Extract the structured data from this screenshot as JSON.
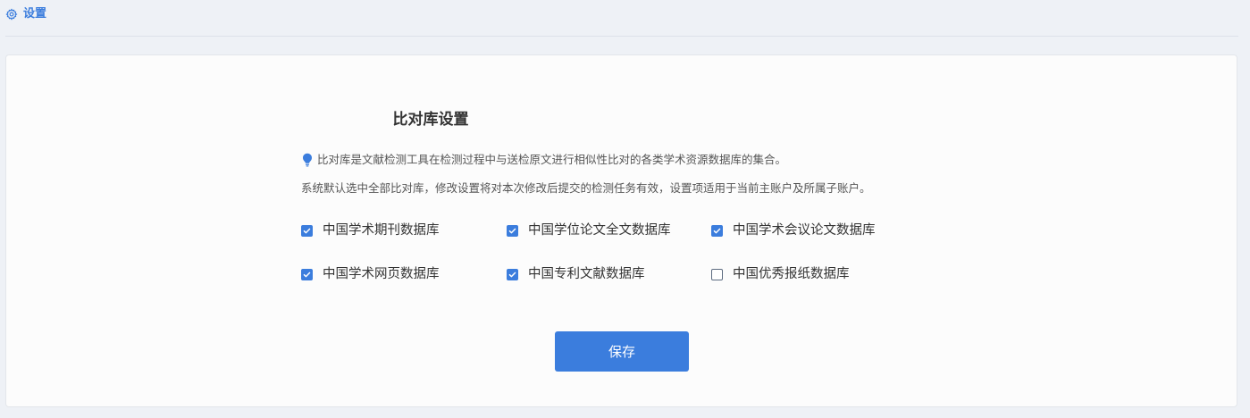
{
  "breadcrumb": {
    "icon": "gear-icon",
    "title": "设置"
  },
  "panel": {
    "heading": "比对库设置",
    "tip_icon": "lightbulb-icon",
    "description_line1": "比对库是文献检测工具在检测过程中与送检原文进行相似性比对的各类学术资源数据库的集合。",
    "description_line2": "系统默认选中全部比对库，修改设置将对本次修改后提交的检测任务有效，设置项适用于当前主账户及所属子账户。"
  },
  "databases": [
    {
      "label": "中国学术期刊数据库",
      "checked": true
    },
    {
      "label": "中国学位论文全文数据库",
      "checked": true
    },
    {
      "label": "中国学术会议论文数据库",
      "checked": true
    },
    {
      "label": "中国学术网页数据库",
      "checked": true
    },
    {
      "label": "中国专利文献数据库",
      "checked": true
    },
    {
      "label": "中国优秀报纸数据库",
      "checked": false
    }
  ],
  "actions": {
    "save_label": "保存"
  },
  "colors": {
    "accent": "#3b7ddd",
    "background": "#eef1f6",
    "card": "#fcfcfc"
  }
}
